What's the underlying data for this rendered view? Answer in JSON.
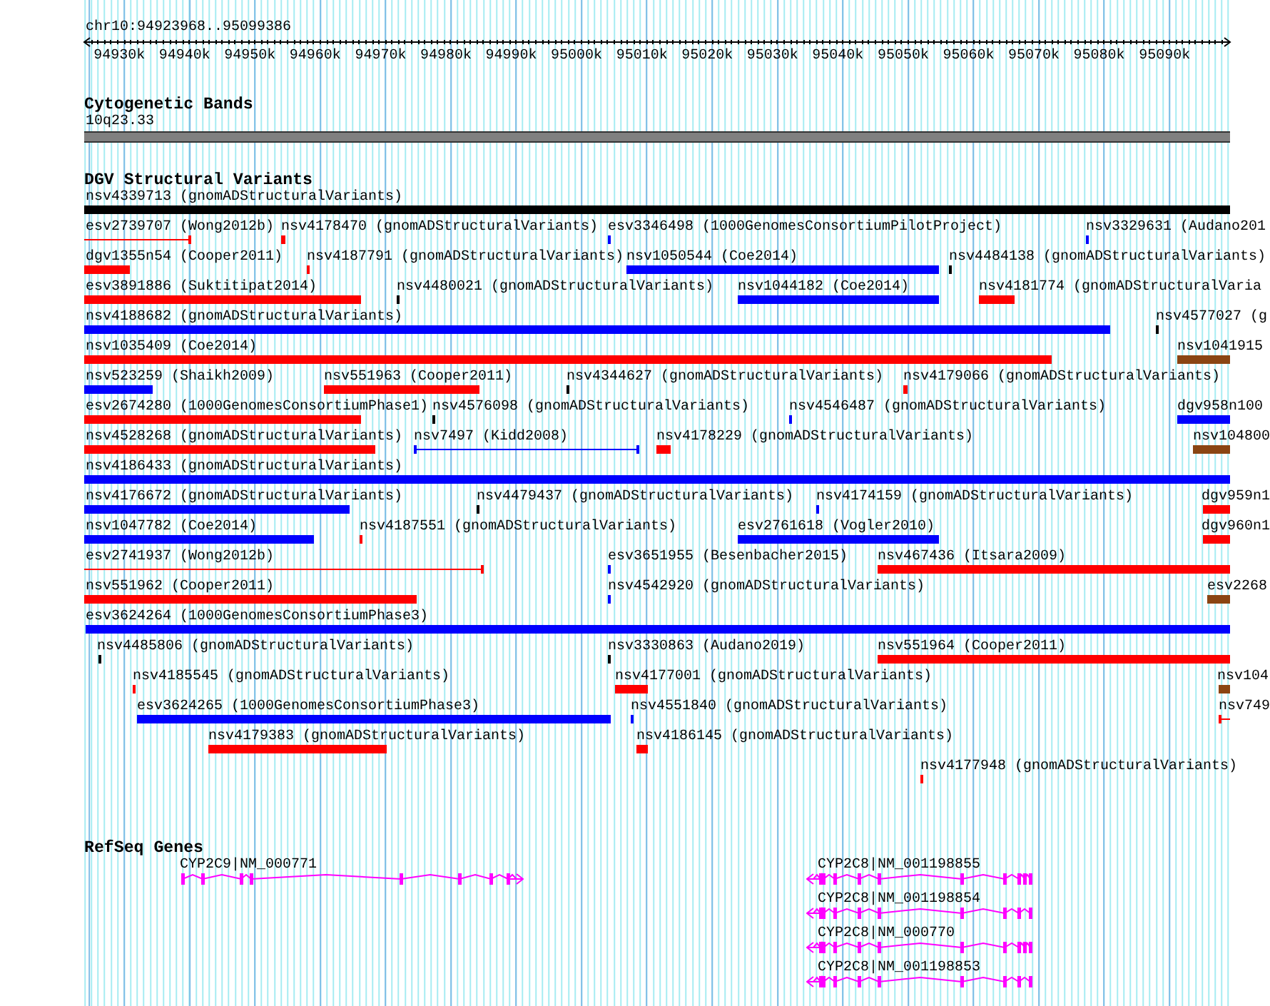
{
  "location": "chr10:94923968..95099386",
  "ruler": {
    "ticks": [
      "94930k",
      "94940k",
      "94950k",
      "94960k",
      "94970k",
      "94980k",
      "94990k",
      "95000k",
      "95010k",
      "95020k",
      "95030k",
      "95040k",
      "95050k",
      "95060k",
      "95070k",
      "95080k",
      "95090k"
    ]
  },
  "cytogenetic_bands": {
    "title": "Cytogenetic Bands",
    "band": "10q23.33"
  },
  "dgv_structural_variants": {
    "title": "DGV Structural Variants",
    "features": [
      {
        "label": "nsv4339713 (gnomADStructuralVariants)",
        "kind": "bar",
        "color": "#000000"
      },
      {
        "label": "esv2739707 (Wong2012b)",
        "kind": "line",
        "color": "#ff0000"
      },
      {
        "label": "nsv4178470 (gnomADStructuralVariants)",
        "kind": "bar",
        "color": "#ff0000"
      },
      {
        "label": "esv3346498 (1000GenomesConsortiumPilotProject)",
        "kind": "bar",
        "color": "#0000ff"
      },
      {
        "label": "nsv3329631 (Audano201",
        "kind": "bar",
        "color": "#0000ff"
      },
      {
        "label": "dgv1355n54 (Cooper2011)",
        "kind": "bar",
        "color": "#ff0000"
      },
      {
        "label": "nsv4187791 (gnomADStructuralVariants)",
        "kind": "bar",
        "color": "#ff0000"
      },
      {
        "label": "nsv1050544 (Coe2014)",
        "kind": "bar",
        "color": "#0000ff"
      },
      {
        "label": "nsv4484138 (gnomADStructuralVariants)",
        "kind": "bar",
        "color": "#000000"
      },
      {
        "label": "esv3891886 (Suktitipat2014)",
        "kind": "bar",
        "color": "#ff0000"
      },
      {
        "label": "nsv4480021 (gnomADStructuralVariants)",
        "kind": "bar",
        "color": "#000000"
      },
      {
        "label": "nsv1044182 (Coe2014)",
        "kind": "bar",
        "color": "#0000ff"
      },
      {
        "label": "nsv4181774 (gnomADStructuralVaria",
        "kind": "bar",
        "color": "#ff0000"
      },
      {
        "label": "nsv4188682 (gnomADStructuralVariants)",
        "kind": "bar",
        "color": "#0000ff"
      },
      {
        "label": "nsv4577027 (g",
        "kind": "bar",
        "color": "#000000"
      },
      {
        "label": "nsv1035409 (Coe2014)",
        "kind": "bar",
        "color": "#ff0000"
      },
      {
        "label": "nsv1041915",
        "kind": "bar",
        "color": "#8b4513"
      },
      {
        "label": "nsv523259 (Shaikh2009)",
        "kind": "bar",
        "color": "#0000ff"
      },
      {
        "label": "nsv551963 (Cooper2011)",
        "kind": "bar",
        "color": "#ff0000"
      },
      {
        "label": "nsv4344627 (gnomADStructuralVariants)",
        "kind": "bar",
        "color": "#000000"
      },
      {
        "label": "nsv4179066 (gnomADStructuralVariants)",
        "kind": "bar",
        "color": "#ff0000"
      },
      {
        "label": "esv2674280 (1000GenomesConsortiumPhase1)",
        "kind": "bar",
        "color": "#ff0000"
      },
      {
        "label": "nsv4576098 (gnomADStructuralVariants)",
        "kind": "bar",
        "color": "#000000"
      },
      {
        "label": "nsv4546487 (gnomADStructuralVariants)",
        "kind": "bar",
        "color": "#0000ff"
      },
      {
        "label": "dgv958n100",
        "kind": "bar",
        "color": "#0000ff"
      },
      {
        "label": "nsv4528268 (gnomADStructuralVariants)",
        "kind": "bar",
        "color": "#ff0000"
      },
      {
        "label": "nsv7497 (Kidd2008)",
        "kind": "line",
        "color": "#0000ff"
      },
      {
        "label": "nsv4178229 (gnomADStructuralVariants)",
        "kind": "bar",
        "color": "#ff0000"
      },
      {
        "label": "nsv104800",
        "kind": "bar",
        "color": "#8b4513"
      },
      {
        "label": "nsv4186433 (gnomADStructuralVariants)",
        "kind": "bar",
        "color": "#0000ff"
      },
      {
        "label": "nsv4176672 (gnomADStructuralVariants)",
        "kind": "bar",
        "color": "#0000ff"
      },
      {
        "label": "nsv4479437 (gnomADStructuralVariants)",
        "kind": "bar",
        "color": "#000000"
      },
      {
        "label": "nsv4174159 (gnomADStructuralVariants)",
        "kind": "bar",
        "color": "#0000ff"
      },
      {
        "label": "dgv959n1",
        "kind": "bar",
        "color": "#ff0000"
      },
      {
        "label": "nsv1047782 (Coe2014)",
        "kind": "bar",
        "color": "#0000ff"
      },
      {
        "label": "nsv4187551 (gnomADStructuralVariants)",
        "kind": "bar",
        "color": "#ff0000"
      },
      {
        "label": "esv2761618 (Vogler2010)",
        "kind": "bar",
        "color": "#0000ff"
      },
      {
        "label": "dgv960n1",
        "kind": "bar",
        "color": "#ff0000"
      },
      {
        "label": "esv2741937 (Wong2012b)",
        "kind": "line",
        "color": "#ff0000"
      },
      {
        "label": "esv3651955 (Besenbacher2015)",
        "kind": "bar",
        "color": "#0000ff"
      },
      {
        "label": "nsv467436 (Itsara2009)",
        "kind": "bar",
        "color": "#ff0000"
      },
      {
        "label": "nsv551962 (Cooper2011)",
        "kind": "bar",
        "color": "#ff0000"
      },
      {
        "label": "nsv4542920 (gnomADStructuralVariants)",
        "kind": "bar",
        "color": "#0000ff"
      },
      {
        "label": "esv2268",
        "kind": "bar",
        "color": "#8b4513"
      },
      {
        "label": "esv3624264 (1000GenomesConsortiumPhase3)",
        "kind": "bar",
        "color": "#0000ff"
      },
      {
        "label": "nsv4485806 (gnomADStructuralVariants)",
        "kind": "bar",
        "color": "#000000"
      },
      {
        "label": "nsv3330863 (Audano2019)",
        "kind": "bar",
        "color": "#000000"
      },
      {
        "label": "nsv551964 (Cooper2011)",
        "kind": "bar",
        "color": "#ff0000"
      },
      {
        "label": "nsv4185545 (gnomADStructuralVariants)",
        "kind": "bar",
        "color": "#ff0000"
      },
      {
        "label": "nsv4177001 (gnomADStructuralVariants)",
        "kind": "bar",
        "color": "#ff0000"
      },
      {
        "label": "nsv104",
        "kind": "bar",
        "color": "#8b4513"
      },
      {
        "label": "esv3624265 (1000GenomesConsortiumPhase3)",
        "kind": "bar",
        "color": "#0000ff"
      },
      {
        "label": "nsv4551840 (gnomADStructuralVariants)",
        "kind": "bar",
        "color": "#0000ff"
      },
      {
        "label": "nsv749",
        "kind": "line",
        "color": "#ff0000"
      },
      {
        "label": "nsv4179383 (gnomADStructuralVariants)",
        "kind": "bar",
        "color": "#ff0000"
      },
      {
        "label": "nsv4186145 (gnomADStructuralVariants)",
        "kind": "bar",
        "color": "#ff0000"
      },
      {
        "label": "nsv4177948 (gnomADStructuralVariants)",
        "kind": "bar",
        "color": "#ff0000"
      }
    ]
  },
  "refseq_genes": {
    "title": "RefSeq Genes",
    "genes": [
      {
        "label": "CYP2C9|NM_000771",
        "kind": "forward"
      },
      {
        "label": "CYP2C8|NM_001198855",
        "kind": "reverse"
      },
      {
        "label": "CYP2C8|NM_001198854",
        "kind": "reverse"
      },
      {
        "label": "CYP2C8|NM_000770",
        "kind": "reverse"
      },
      {
        "label": "CYP2C8|NM_001198853",
        "kind": "reverse"
      }
    ]
  }
}
